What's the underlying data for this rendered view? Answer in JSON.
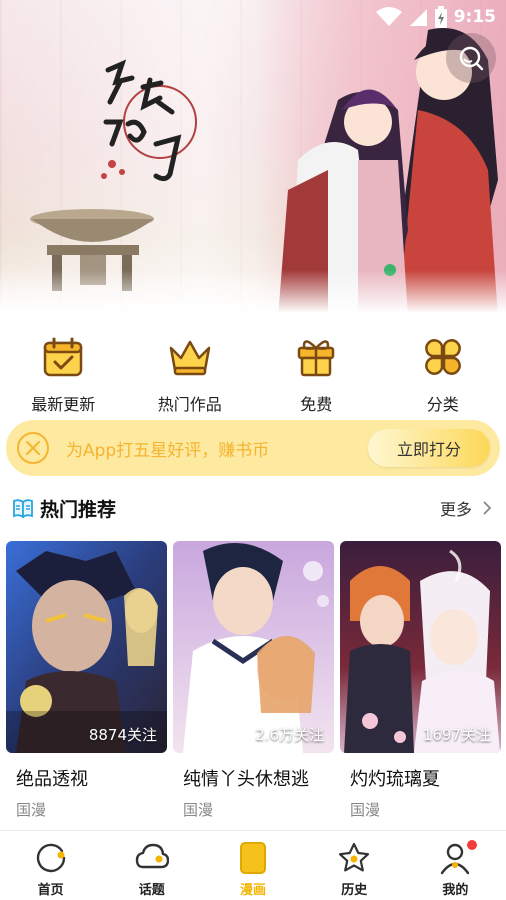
{
  "status_bar": {
    "time": "9:15"
  },
  "banner": {
    "title_art_icon": "hong-yan-ru-xi-calligraphy",
    "search_icon": "search-icon"
  },
  "quick_nav": [
    {
      "label": "最新更新",
      "icon": "calendar-check-icon"
    },
    {
      "label": "热门作品",
      "icon": "crown-icon"
    },
    {
      "label": "免费",
      "icon": "gift-icon"
    },
    {
      "label": "分类",
      "icon": "clover-grid-icon"
    }
  ],
  "rating_banner": {
    "text": "为App打五星好评，赚书币",
    "button": "立即打分"
  },
  "section": {
    "title": "热门推荐",
    "more": "更多"
  },
  "cards": [
    {
      "title": "绝品透视",
      "tag": "国漫",
      "follow": "8874关注"
    },
    {
      "title": "纯情丫头休想逃",
      "tag": "国漫",
      "follow": "2.6万关注"
    },
    {
      "title": "灼灼琉璃夏",
      "tag": "国漫",
      "follow": "1697关注"
    }
  ],
  "bottom_nav": [
    {
      "label": "首页",
      "icon": "home-icon"
    },
    {
      "label": "话题",
      "icon": "topic-icon"
    },
    {
      "label": "漫画",
      "icon": "comic-icon",
      "active": true
    },
    {
      "label": "历史",
      "icon": "star-history-icon"
    },
    {
      "label": "我的",
      "icon": "profile-icon",
      "badge": true
    }
  ],
  "colors": {
    "accent": "#f4b400",
    "rate_bg": "#fde9a0",
    "rate_text": "#f5b431",
    "badge": "#f23b3b"
  }
}
